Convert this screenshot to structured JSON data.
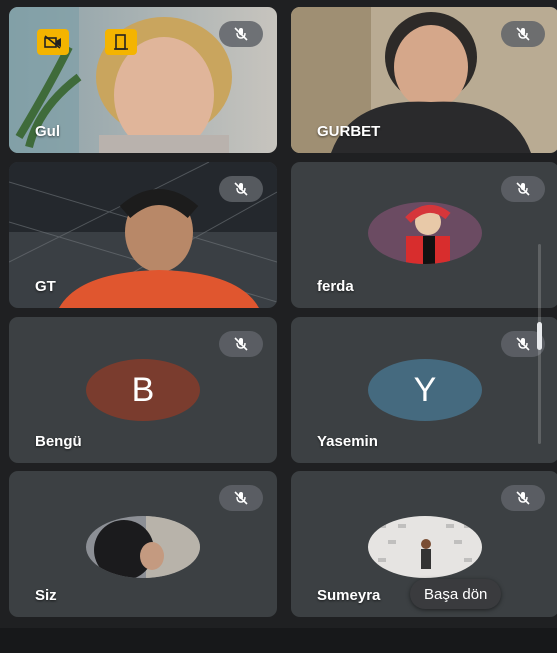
{
  "participants": [
    {
      "name": "Gul"
    },
    {
      "name": "GURBET"
    },
    {
      "name": "GT"
    },
    {
      "name": "ferda"
    },
    {
      "name": "Bengü",
      "initial": "B"
    },
    {
      "name": "Yasemin",
      "initial": "Y"
    },
    {
      "name": "Siz"
    },
    {
      "name": "Sumeyra"
    }
  ],
  "toast": {
    "label": "Başa dön"
  },
  "colors": {
    "tile_bg": "#3c4043",
    "avatar_bengu": "#7a3c2e",
    "avatar_yasemin": "#456a7f",
    "badge_yellow": "#f4b400"
  },
  "icons": [
    "mic-off-icon",
    "camera-off-icon",
    "door-exit-icon"
  ]
}
